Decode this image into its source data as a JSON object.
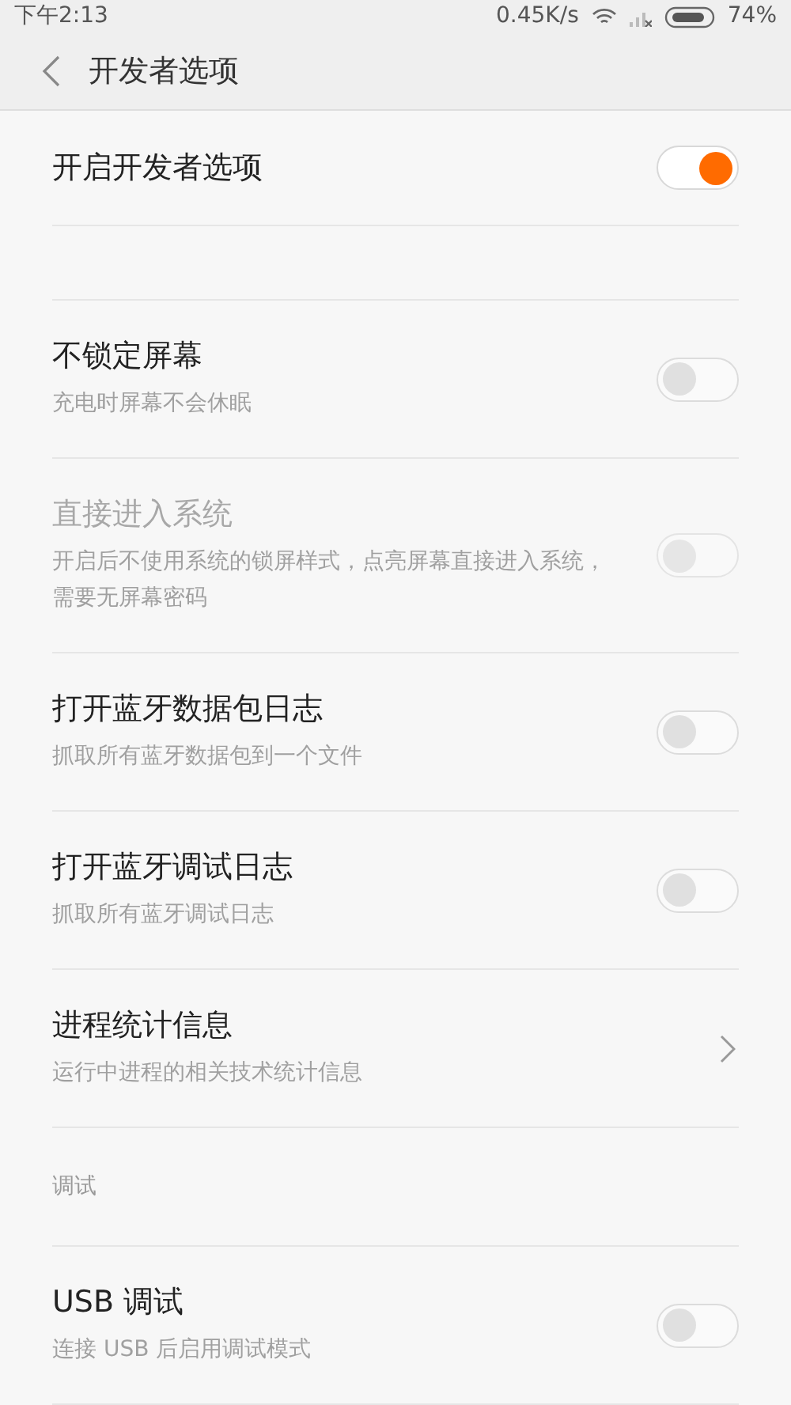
{
  "status_bar": {
    "time": "下午2:13",
    "speed": "0.45K/s",
    "battery": "74%"
  },
  "header": {
    "title": "开发者选项"
  },
  "items": [
    {
      "kind": "toggle",
      "title": "开启开发者选项",
      "on": true,
      "disabled": false
    },
    {
      "kind": "spacer"
    },
    {
      "kind": "toggle",
      "title": "不锁定屏幕",
      "subtitle": "充电时屏幕不会休眠",
      "on": false,
      "disabled": false
    },
    {
      "kind": "toggle",
      "title": "直接进入系统",
      "subtitle": "开启后不使用系统的锁屏样式，点亮屏幕直接进入系统，需要无屏幕密码",
      "on": false,
      "disabled": true
    },
    {
      "kind": "toggle",
      "title": "打开蓝牙数据包日志",
      "subtitle": "抓取所有蓝牙数据包到一个文件",
      "on": false,
      "disabled": false
    },
    {
      "kind": "toggle",
      "title": "打开蓝牙调试日志",
      "subtitle": "抓取所有蓝牙调试日志",
      "on": false,
      "disabled": false
    },
    {
      "kind": "link",
      "title": "进程统计信息",
      "subtitle": "运行中进程的相关技术统计信息"
    },
    {
      "kind": "section",
      "title": "调试"
    },
    {
      "kind": "toggle",
      "title": "USB 调试",
      "subtitle": "连接 USB 后启用调试模式",
      "on": false,
      "disabled": false
    }
  ]
}
